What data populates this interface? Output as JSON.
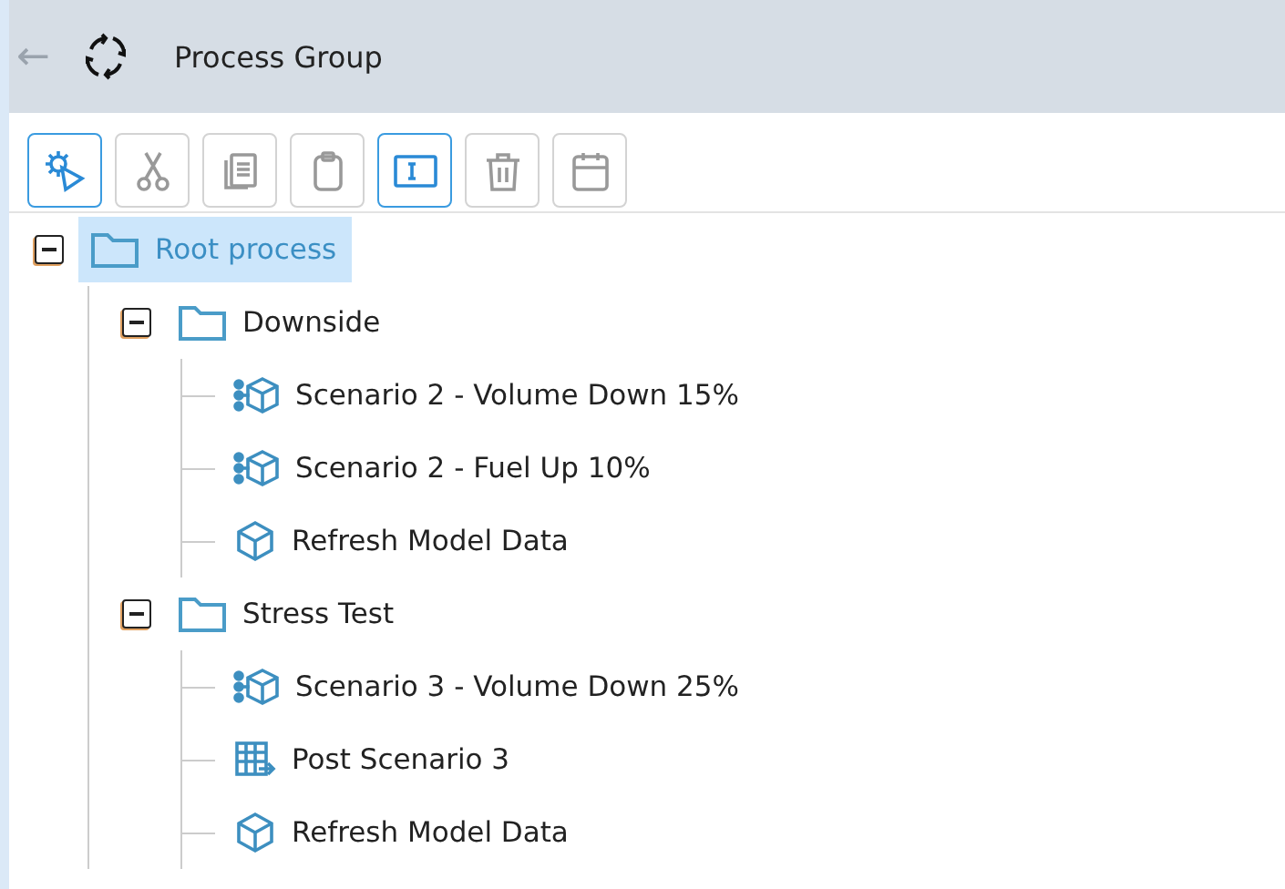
{
  "header": {
    "back": "←",
    "title": "Process Group"
  },
  "toolbar": [
    {
      "kind": "run",
      "disabled": false
    },
    {
      "kind": "cut",
      "disabled": true
    },
    {
      "kind": "copy",
      "disabled": true
    },
    {
      "kind": "paste",
      "disabled": true
    },
    {
      "kind": "rename",
      "disabled": false
    },
    {
      "kind": "delete",
      "disabled": true
    },
    {
      "kind": "schedule",
      "disabled": true
    }
  ],
  "tree": [
    {
      "kind": "folder",
      "label": "Root process",
      "selected": true,
      "expanded": true,
      "children": [
        {
          "kind": "folder",
          "label": "Downside",
          "selected": false,
          "expanded": true,
          "children": [
            {
              "kind": "scenario",
              "label": "Scenario 2 - Volume Down 15%",
              "selected": false
            },
            {
              "kind": "scenario",
              "label": "Scenario 2 - Fuel Up 10%",
              "selected": false
            },
            {
              "kind": "refresh",
              "label": "Refresh Model Data",
              "selected": false
            }
          ]
        },
        {
          "kind": "folder",
          "label": "Stress Test",
          "selected": false,
          "expanded": true,
          "children": [
            {
              "kind": "scenario",
              "label": "Scenario 3 - Volume Down 25%",
              "selected": false
            },
            {
              "kind": "post",
              "label": "Post Scenario 3",
              "selected": false
            },
            {
              "kind": "refresh",
              "label": "Refresh Model Data",
              "selected": false
            }
          ]
        }
      ]
    }
  ]
}
